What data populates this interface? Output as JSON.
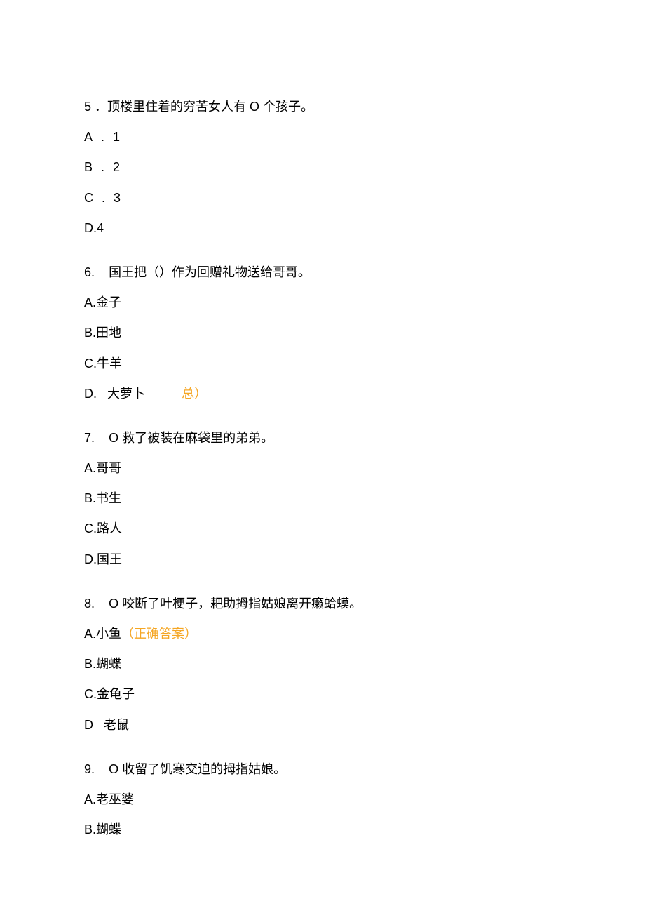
{
  "questions": [
    {
      "number": "5",
      "text": "．顶楼里住着的穷苦女人有 O 个孩子。",
      "options": [
        {
          "label": "A.",
          "value": "1",
          "spaced": true
        },
        {
          "label": "B.",
          "value": "2",
          "spaced": true
        },
        {
          "label": "C.",
          "value": "3",
          "spaced": true
        },
        {
          "label": "D.4",
          "value": "",
          "spaced": false
        }
      ]
    },
    {
      "number": "6.",
      "text": "国王把（）作为回赠礼物送给哥哥。",
      "options": [
        {
          "label": "A.",
          "value": "金子"
        },
        {
          "label": "B.",
          "value": "田地"
        },
        {
          "label": "C.",
          "value": "牛羊"
        },
        {
          "label": "D.",
          "value": "大萝卜",
          "extra": "总）",
          "extraCorrect": true,
          "gap": true
        }
      ]
    },
    {
      "number": "7.",
      "text": "O 救了被装在麻袋里的弟弟。",
      "options": [
        {
          "label": "A.",
          "value": "哥哥"
        },
        {
          "label": "B.",
          "value": "书生"
        },
        {
          "label": "C.",
          "value": "路人"
        },
        {
          "label": "D.",
          "value": "国王"
        }
      ]
    },
    {
      "number": "8.",
      "text": "O 咬断了叶梗子，耙助拇指姑娘离开癞蛤蟆。",
      "options": [
        {
          "label": "A.",
          "value": "小",
          "underlineValue": "鱼",
          "correct": "（正确答案）"
        },
        {
          "label": "B.",
          "value": "蝴蝶"
        },
        {
          "label": "C.",
          "value": "金龟子"
        },
        {
          "label": "D",
          "value": "老鼠",
          "dspace": true
        }
      ]
    },
    {
      "number": "9.",
      "text": "O 收留了饥寒交迫的拇指姑娘。",
      "options": [
        {
          "label": "A.",
          "value": "老巫婆"
        },
        {
          "label": "B.",
          "value": "蝴蝶"
        }
      ]
    }
  ]
}
